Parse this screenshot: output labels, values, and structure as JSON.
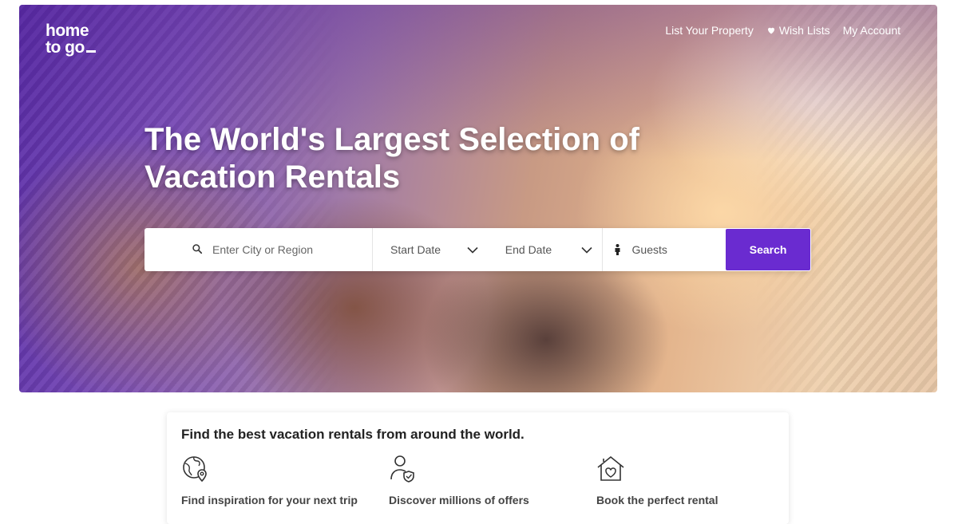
{
  "brand": {
    "logo_line1": "home",
    "logo_line2": "to go"
  },
  "topnav": {
    "list_property": "List Your Property",
    "wish_lists": "Wish Lists",
    "my_account": "My Account"
  },
  "hero": {
    "headline": "The World's Largest Selection of Vacation Rentals"
  },
  "search": {
    "city_placeholder": "Enter City or Region",
    "start_date": "Start Date",
    "end_date": "End Date",
    "guests": "Guests",
    "button": "Search",
    "accent_color": "#6a2bd0"
  },
  "info": {
    "title": "Find the best vacation rentals from around the world.",
    "features": [
      {
        "icon": "globe-pin-icon",
        "label": "Find inspiration for your next trip"
      },
      {
        "icon": "person-shield-icon",
        "label": "Discover millions of offers"
      },
      {
        "icon": "house-heart-icon",
        "label": "Book the perfect rental"
      }
    ]
  }
}
